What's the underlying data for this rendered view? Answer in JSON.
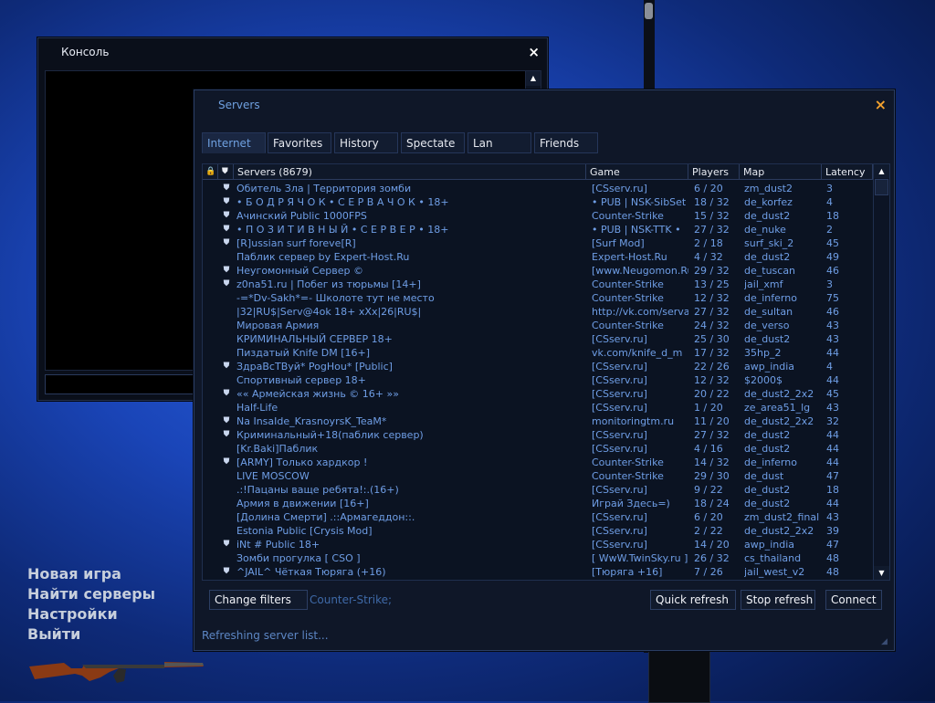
{
  "console": {
    "title": "Консоль",
    "close_icon": "×"
  },
  "servers_window": {
    "title": "Servers",
    "close_icon": "×",
    "tabs": [
      {
        "label": "Internet",
        "active": true
      },
      {
        "label": "Favorites",
        "active": false
      },
      {
        "label": "History",
        "active": false
      },
      {
        "label": "Spectate",
        "active": false
      },
      {
        "label": "Lan",
        "active": false
      },
      {
        "label": "Friends",
        "active": false
      }
    ],
    "columns": {
      "lock_icon": "🔒",
      "vac_icon": "⛊",
      "name": "Servers (8679)",
      "game": "Game",
      "players": "Players",
      "map": "Map",
      "latency": "Latency"
    },
    "rows": [
      {
        "vac": true,
        "name": "Обитель Зла | Территория зомби",
        "game": "[CSserv.ru]",
        "players": "6 / 20",
        "map": "zm_dust2",
        "latency": "3"
      },
      {
        "vac": true,
        "name": "• Б О Д Р Я Ч О К • С Е Р В А Ч О К • 18+",
        "game": "• PUB | NSK-SibSet •",
        "players": "18 / 32",
        "map": "de_korfez",
        "latency": "4"
      },
      {
        "vac": true,
        "name": "Ачинский Public 1000FPS",
        "game": "Counter-Strike",
        "players": "15 / 32",
        "map": "de_dust2",
        "latency": "18"
      },
      {
        "vac": true,
        "name": "• П О З И Т И В Н Ы Й • С Е Р В Е Р • 18+",
        "game": "• PUB | NSK-TTK •",
        "players": "27 / 32",
        "map": "de_nuke",
        "latency": "2"
      },
      {
        "vac": true,
        "name": "[R]ussian surf foreve[R]",
        "game": "[Surf Mod]",
        "players": "2 / 18",
        "map": "surf_ski_2",
        "latency": "45"
      },
      {
        "vac": false,
        "name": "Паблик сервер by Expert-Host.Ru",
        "game": "Expert-Host.Ru",
        "players": "4 / 32",
        "map": "de_dust2",
        "latency": "49"
      },
      {
        "vac": true,
        "name": "Неугомонный Сервер ©",
        "game": "[www.Neugomon.Ru]",
        "players": "29 / 32",
        "map": "de_tuscan",
        "latency": "46"
      },
      {
        "vac": true,
        "name": "z0na51.ru | Побег из тюрьмы [14+]",
        "game": "Counter-Strike",
        "players": "13 / 25",
        "map": "jail_xmf",
        "latency": "3"
      },
      {
        "vac": false,
        "name": "-=*Dv-Sakh*=- Школоте тут не место",
        "game": "Counter-Strike",
        "players": "12 / 32",
        "map": "de_inferno",
        "latency": "75"
      },
      {
        "vac": false,
        "name": "|32|RU$|Serv@4ok 18+ xXx|26|RU$|",
        "game": "http://vk.com/serva...",
        "players": "27 / 32",
        "map": "de_sultan",
        "latency": "46"
      },
      {
        "vac": false,
        "name": "Мировая Армия",
        "game": "Counter-Strike",
        "players": "24 / 32",
        "map": "de_verso",
        "latency": "43"
      },
      {
        "vac": false,
        "name": "КРИМИНАЛЬНЫЙ СЕРВЕР 18+",
        "game": "[CSserv.ru]",
        "players": "25 / 30",
        "map": "de_dust2",
        "latency": "43"
      },
      {
        "vac": false,
        "name": "Пиздатый Knife DM [16+]",
        "game": "vk.com/knife_d_m",
        "players": "17 / 32",
        "map": "35hp_2",
        "latency": "44"
      },
      {
        "vac": true,
        "name": "ЗдраВсТВуй* PogHou* [Public]",
        "game": "[CSserv.ru]",
        "players": "22 / 26",
        "map": "awp_india",
        "latency": "4"
      },
      {
        "vac": false,
        "name": "Спортивный сервер 18+",
        "game": "[CSserv.ru]",
        "players": "12 / 32",
        "map": "$2000$",
        "latency": "44"
      },
      {
        "vac": true,
        "name": "«« Армейская жизнь © 16+ »»",
        "game": "[CSserv.ru]",
        "players": "20 / 22",
        "map": "de_dust2_2x2",
        "latency": "45"
      },
      {
        "vac": false,
        "name": "Half-Life",
        "game": "[CSserv.ru]",
        "players": "1 / 20",
        "map": "ze_area51_lg",
        "latency": "43"
      },
      {
        "vac": true,
        "name": "Na InsaIde_KrasnoyrsK_TeaM*",
        "game": "monitoringtm.ru",
        "players": "11 / 20",
        "map": "de_dust2_2x2",
        "latency": "32"
      },
      {
        "vac": true,
        "name": "Криминальный+18(паблик сервер)",
        "game": "[CSserv.ru]",
        "players": "27 / 32",
        "map": "de_dust2",
        "latency": "44"
      },
      {
        "vac": false,
        "name": "[Kr.Baki]Паблик",
        "game": "[CSserv.ru]",
        "players": "4 / 16",
        "map": "de_dust2",
        "latency": "44"
      },
      {
        "vac": true,
        "name": "[ARMY] Только хардкор !",
        "game": "Counter-Strike",
        "players": "14 / 32",
        "map": "de_inferno",
        "latency": "44"
      },
      {
        "vac": false,
        "name": "LIVE MOSCOW",
        "game": "Counter-Strike",
        "players": "29 / 30",
        "map": "de_dust",
        "latency": "47"
      },
      {
        "vac": false,
        "name": ".:!Пацаны ваще ребята!:.(16+)",
        "game": "[CSserv.ru]",
        "players": "9 / 22",
        "map": "de_dust2",
        "latency": "18"
      },
      {
        "vac": false,
        "name": "Армия в движении [16+]",
        "game": "Играй Здесь=)",
        "players": "18 / 24",
        "map": "de_dust2",
        "latency": "44"
      },
      {
        "vac": false,
        "name": "[Долина Смерти] .::Армагеддон::.",
        "game": "[CSserv.ru]",
        "players": "6 / 20",
        "map": "zm_dust2_final",
        "latency": "43"
      },
      {
        "vac": false,
        "name": "Estonia Public [Crysis Mod]",
        "game": "[CSserv.ru]",
        "players": "2 / 22",
        "map": "de_dust2_2x2",
        "latency": "39"
      },
      {
        "vac": true,
        "name": "iNt # Public 18+",
        "game": "[CSserv.ru]",
        "players": "14 / 20",
        "map": "awp_india",
        "latency": "47"
      },
      {
        "vac": false,
        "name": "Зомби прогулка [ CSO ]",
        "game": "[ WwW.TwinSky.ru ]",
        "players": "26 / 32",
        "map": "cs_thailand",
        "latency": "48"
      },
      {
        "vac": true,
        "name": "^JAIL^ Чёткая Тюряга (+16)",
        "game": "[Тюряга +16]",
        "players": "7 / 26",
        "map": "jail_west_v2",
        "latency": "48"
      }
    ],
    "buttons": {
      "change_filters": "Change filters",
      "quick_refresh": "Quick refresh",
      "stop_refresh": "Stop refresh",
      "connect": "Connect"
    },
    "filter_summary": "Counter-Strike;",
    "status": "Refreshing server list..."
  },
  "main_menu": {
    "items": [
      "Новая игра",
      "Найти серверы",
      "Настройки",
      "Выйти"
    ]
  }
}
